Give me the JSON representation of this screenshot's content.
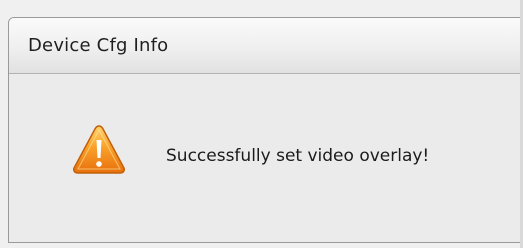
{
  "dialog": {
    "title": "Device Cfg Info",
    "icon": "warning-icon",
    "message": "Successfully set video overlay!"
  },
  "colors": {
    "icon_fill_top": "#ffc24a",
    "icon_fill_bottom": "#e8700c",
    "icon_stroke": "#c2600a"
  }
}
